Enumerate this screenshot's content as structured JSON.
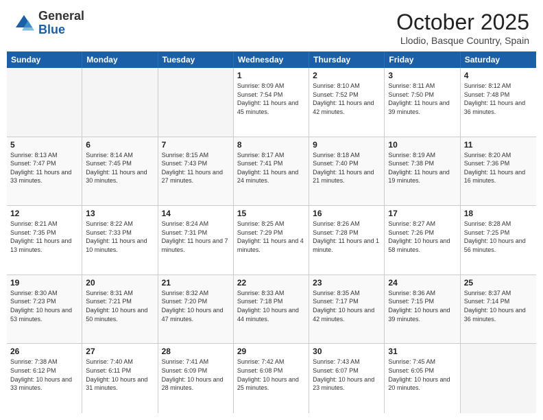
{
  "header": {
    "logo_general": "General",
    "logo_blue": "Blue",
    "month_title": "October 2025",
    "location": "Llodio, Basque Country, Spain"
  },
  "weekdays": [
    "Sunday",
    "Monday",
    "Tuesday",
    "Wednesday",
    "Thursday",
    "Friday",
    "Saturday"
  ],
  "weeks": [
    [
      {
        "day": "",
        "sunrise": "",
        "sunset": "",
        "daylight": "",
        "empty": true
      },
      {
        "day": "",
        "sunrise": "",
        "sunset": "",
        "daylight": "",
        "empty": true
      },
      {
        "day": "",
        "sunrise": "",
        "sunset": "",
        "daylight": "",
        "empty": true
      },
      {
        "day": "1",
        "sunrise": "Sunrise: 8:09 AM",
        "sunset": "Sunset: 7:54 PM",
        "daylight": "Daylight: 11 hours and 45 minutes."
      },
      {
        "day": "2",
        "sunrise": "Sunrise: 8:10 AM",
        "sunset": "Sunset: 7:52 PM",
        "daylight": "Daylight: 11 hours and 42 minutes."
      },
      {
        "day": "3",
        "sunrise": "Sunrise: 8:11 AM",
        "sunset": "Sunset: 7:50 PM",
        "daylight": "Daylight: 11 hours and 39 minutes."
      },
      {
        "day": "4",
        "sunrise": "Sunrise: 8:12 AM",
        "sunset": "Sunset: 7:48 PM",
        "daylight": "Daylight: 11 hours and 36 minutes."
      }
    ],
    [
      {
        "day": "5",
        "sunrise": "Sunrise: 8:13 AM",
        "sunset": "Sunset: 7:47 PM",
        "daylight": "Daylight: 11 hours and 33 minutes."
      },
      {
        "day": "6",
        "sunrise": "Sunrise: 8:14 AM",
        "sunset": "Sunset: 7:45 PM",
        "daylight": "Daylight: 11 hours and 30 minutes."
      },
      {
        "day": "7",
        "sunrise": "Sunrise: 8:15 AM",
        "sunset": "Sunset: 7:43 PM",
        "daylight": "Daylight: 11 hours and 27 minutes."
      },
      {
        "day": "8",
        "sunrise": "Sunrise: 8:17 AM",
        "sunset": "Sunset: 7:41 PM",
        "daylight": "Daylight: 11 hours and 24 minutes."
      },
      {
        "day": "9",
        "sunrise": "Sunrise: 8:18 AM",
        "sunset": "Sunset: 7:40 PM",
        "daylight": "Daylight: 11 hours and 21 minutes."
      },
      {
        "day": "10",
        "sunrise": "Sunrise: 8:19 AM",
        "sunset": "Sunset: 7:38 PM",
        "daylight": "Daylight: 11 hours and 19 minutes."
      },
      {
        "day": "11",
        "sunrise": "Sunrise: 8:20 AM",
        "sunset": "Sunset: 7:36 PM",
        "daylight": "Daylight: 11 hours and 16 minutes."
      }
    ],
    [
      {
        "day": "12",
        "sunrise": "Sunrise: 8:21 AM",
        "sunset": "Sunset: 7:35 PM",
        "daylight": "Daylight: 11 hours and 13 minutes."
      },
      {
        "day": "13",
        "sunrise": "Sunrise: 8:22 AM",
        "sunset": "Sunset: 7:33 PM",
        "daylight": "Daylight: 11 hours and 10 minutes."
      },
      {
        "day": "14",
        "sunrise": "Sunrise: 8:24 AM",
        "sunset": "Sunset: 7:31 PM",
        "daylight": "Daylight: 11 hours and 7 minutes."
      },
      {
        "day": "15",
        "sunrise": "Sunrise: 8:25 AM",
        "sunset": "Sunset: 7:29 PM",
        "daylight": "Daylight: 11 hours and 4 minutes."
      },
      {
        "day": "16",
        "sunrise": "Sunrise: 8:26 AM",
        "sunset": "Sunset: 7:28 PM",
        "daylight": "Daylight: 11 hours and 1 minute."
      },
      {
        "day": "17",
        "sunrise": "Sunrise: 8:27 AM",
        "sunset": "Sunset: 7:26 PM",
        "daylight": "Daylight: 10 hours and 58 minutes."
      },
      {
        "day": "18",
        "sunrise": "Sunrise: 8:28 AM",
        "sunset": "Sunset: 7:25 PM",
        "daylight": "Daylight: 10 hours and 56 minutes."
      }
    ],
    [
      {
        "day": "19",
        "sunrise": "Sunrise: 8:30 AM",
        "sunset": "Sunset: 7:23 PM",
        "daylight": "Daylight: 10 hours and 53 minutes."
      },
      {
        "day": "20",
        "sunrise": "Sunrise: 8:31 AM",
        "sunset": "Sunset: 7:21 PM",
        "daylight": "Daylight: 10 hours and 50 minutes."
      },
      {
        "day": "21",
        "sunrise": "Sunrise: 8:32 AM",
        "sunset": "Sunset: 7:20 PM",
        "daylight": "Daylight: 10 hours and 47 minutes."
      },
      {
        "day": "22",
        "sunrise": "Sunrise: 8:33 AM",
        "sunset": "Sunset: 7:18 PM",
        "daylight": "Daylight: 10 hours and 44 minutes."
      },
      {
        "day": "23",
        "sunrise": "Sunrise: 8:35 AM",
        "sunset": "Sunset: 7:17 PM",
        "daylight": "Daylight: 10 hours and 42 minutes."
      },
      {
        "day": "24",
        "sunrise": "Sunrise: 8:36 AM",
        "sunset": "Sunset: 7:15 PM",
        "daylight": "Daylight: 10 hours and 39 minutes."
      },
      {
        "day": "25",
        "sunrise": "Sunrise: 8:37 AM",
        "sunset": "Sunset: 7:14 PM",
        "daylight": "Daylight: 10 hours and 36 minutes."
      }
    ],
    [
      {
        "day": "26",
        "sunrise": "Sunrise: 7:38 AM",
        "sunset": "Sunset: 6:12 PM",
        "daylight": "Daylight: 10 hours and 33 minutes."
      },
      {
        "day": "27",
        "sunrise": "Sunrise: 7:40 AM",
        "sunset": "Sunset: 6:11 PM",
        "daylight": "Daylight: 10 hours and 31 minutes."
      },
      {
        "day": "28",
        "sunrise": "Sunrise: 7:41 AM",
        "sunset": "Sunset: 6:09 PM",
        "daylight": "Daylight: 10 hours and 28 minutes."
      },
      {
        "day": "29",
        "sunrise": "Sunrise: 7:42 AM",
        "sunset": "Sunset: 6:08 PM",
        "daylight": "Daylight: 10 hours and 25 minutes."
      },
      {
        "day": "30",
        "sunrise": "Sunrise: 7:43 AM",
        "sunset": "Sunset: 6:07 PM",
        "daylight": "Daylight: 10 hours and 23 minutes."
      },
      {
        "day": "31",
        "sunrise": "Sunrise: 7:45 AM",
        "sunset": "Sunset: 6:05 PM",
        "daylight": "Daylight: 10 hours and 20 minutes."
      },
      {
        "day": "",
        "sunrise": "",
        "sunset": "",
        "daylight": "",
        "empty": true
      }
    ]
  ]
}
